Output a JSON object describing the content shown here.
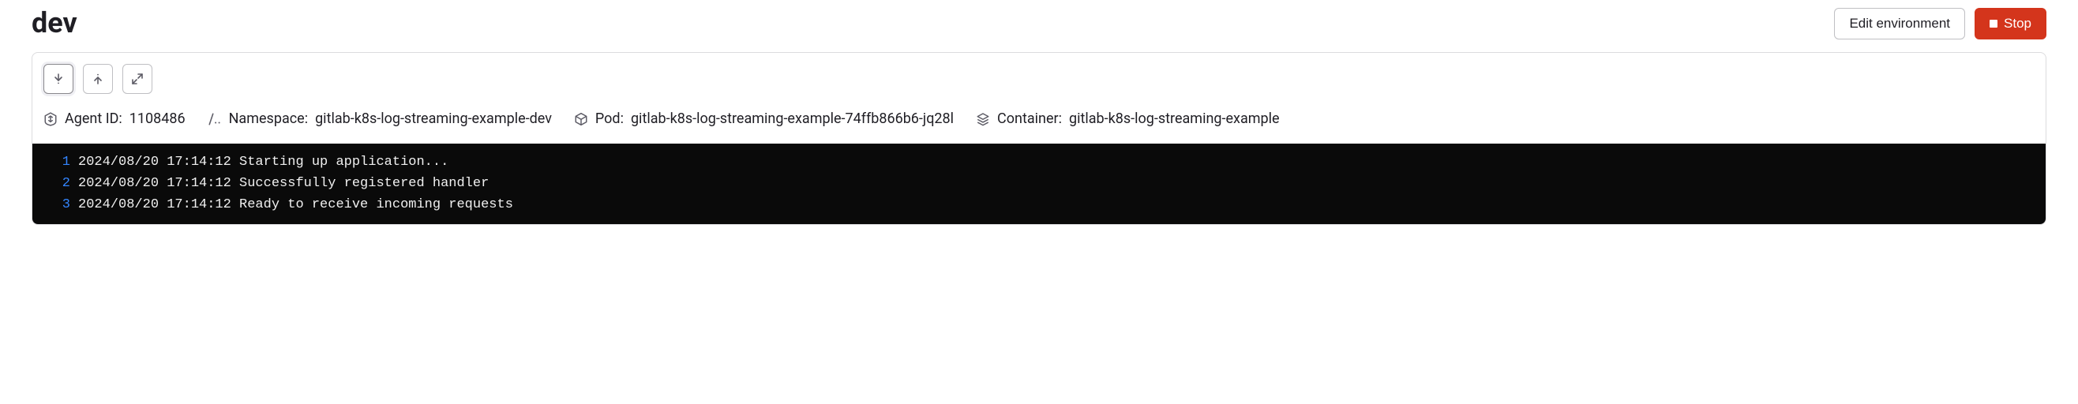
{
  "title": "dev",
  "actions": {
    "edit_label": "Edit environment",
    "stop_label": "Stop"
  },
  "toolbar": {
    "scroll_down_title": "Scroll to latest",
    "scroll_up_title": "Scroll to top",
    "expand_title": "Full screen"
  },
  "meta": {
    "agent_label": "Agent ID:",
    "agent_id": "1108486",
    "namespace_label": "Namespace:",
    "namespace": "gitlab-k8s-log-streaming-example-dev",
    "pod_label": "Pod:",
    "pod": "gitlab-k8s-log-streaming-example-74ffb866b6-jq28l",
    "container_label": "Container:",
    "container": "gitlab-k8s-log-streaming-example"
  },
  "logs": [
    {
      "n": "1",
      "text": "2024/08/20 17:14:12 Starting up application..."
    },
    {
      "n": "2",
      "text": "2024/08/20 17:14:12 Successfully registered handler"
    },
    {
      "n": "3",
      "text": "2024/08/20 17:14:12 Ready to receive incoming requests"
    }
  ]
}
